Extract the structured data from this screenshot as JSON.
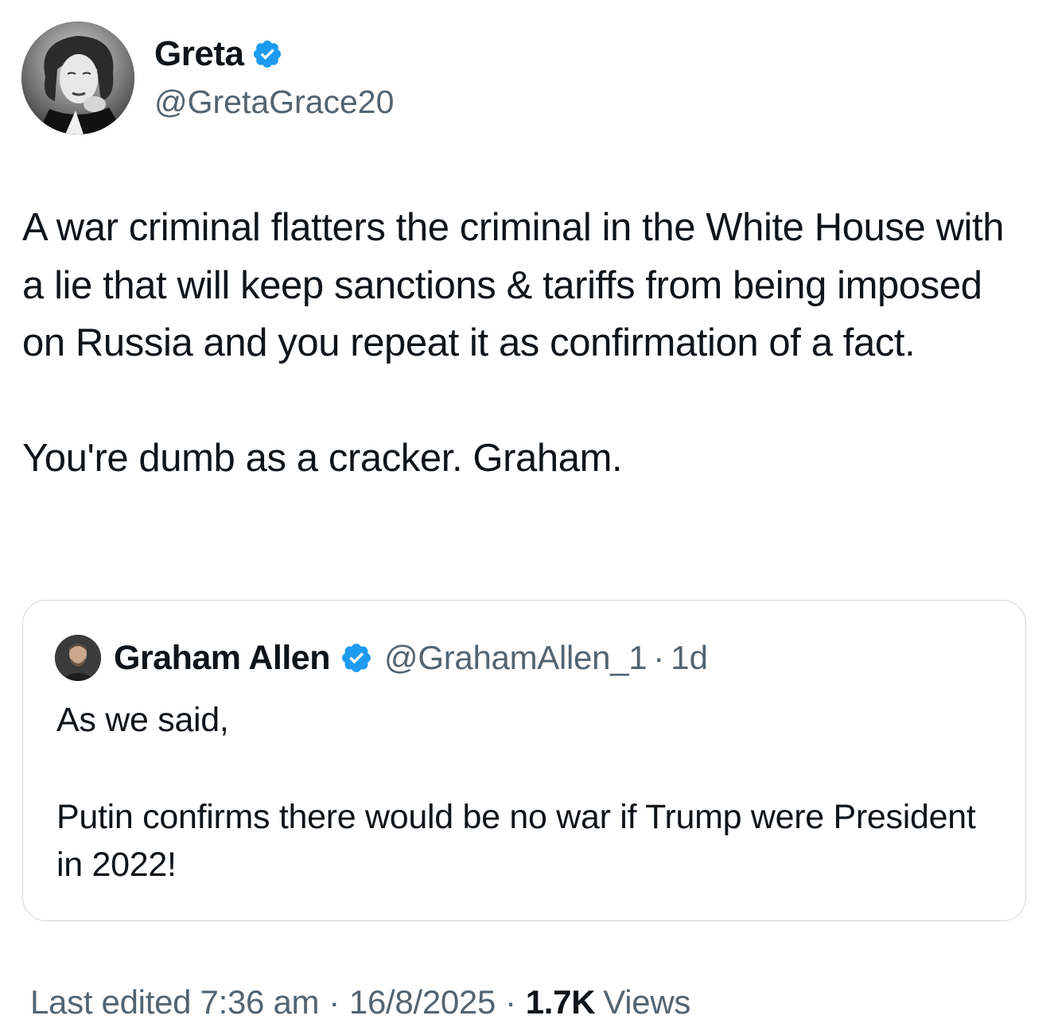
{
  "author": {
    "display_name": "Greta",
    "handle": "@GretaGrace20",
    "verified": true,
    "avatar_icon": "portrait-avatar"
  },
  "tweet": {
    "paragraphs": [
      "A war criminal flatters the criminal in the White House with a lie that will keep sanctions & tariffs from being imposed on Russia and you repeat it as confirmation of a fact.",
      "You're dumb as a cracker. Graham."
    ]
  },
  "quoted_tweet": {
    "display_name": "Graham Allen",
    "handle": "@GrahamAllen_1",
    "separator": "·",
    "time": "1d",
    "verified": true,
    "avatar_icon": "portrait-avatar",
    "paragraphs": [
      "As we said,",
      "Putin confirms there would be no war if Trump were President in 2022!"
    ]
  },
  "meta": {
    "edited_label": "Last edited 7:36 am",
    "separator": "·",
    "date": "16/8/2025",
    "views_count": "1.7K",
    "views_label": "Views"
  },
  "colors": {
    "text_primary": "#0f1419",
    "text_secondary": "#536471",
    "verified_blue": "#1d9bf0",
    "border": "#cfd9de"
  }
}
